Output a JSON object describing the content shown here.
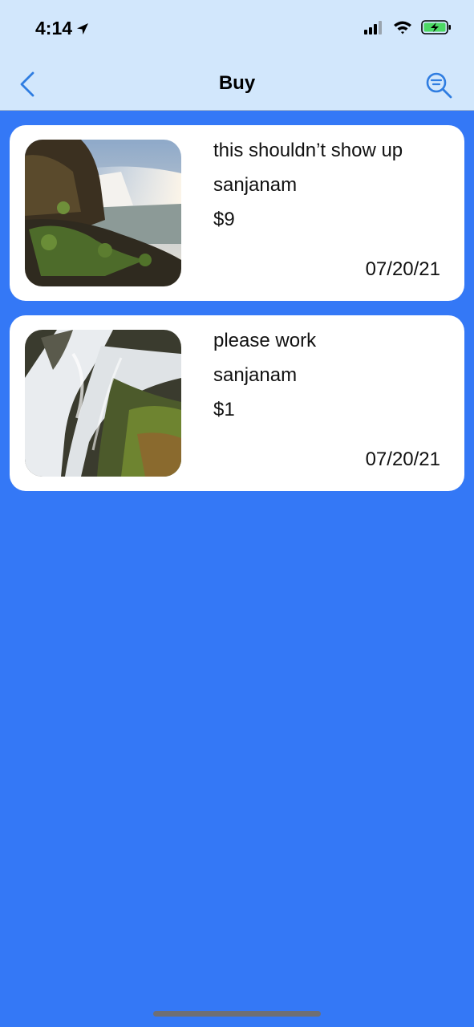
{
  "status_bar": {
    "time": "4:14",
    "location_icon": "location-arrow-icon",
    "signal_icon": "cellular-signal-icon",
    "wifi_icon": "wifi-icon",
    "battery_icon": "battery-charging-icon"
  },
  "nav": {
    "title": "Buy",
    "back_icon": "chevron-left-icon",
    "search_icon": "search-filter-icon"
  },
  "listings": [
    {
      "title": "this shouldn’t show up",
      "seller": "sanjanam",
      "price": "$9",
      "date": "07/20/21",
      "image": "waterfall-landscape"
    },
    {
      "title": "please work",
      "seller": "sanjanam",
      "price": "$1",
      "date": "07/20/21",
      "image": "waterfall-closeup"
    }
  ],
  "colors": {
    "background": "#3478f6",
    "header": "#d2e7fc",
    "accent": "#2f7de1",
    "card": "#ffffff",
    "battery_fill": "#4cd964"
  }
}
